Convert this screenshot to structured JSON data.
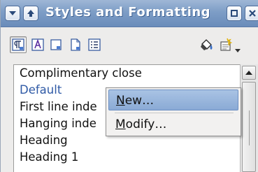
{
  "window": {
    "title": "Styles and Formatting"
  },
  "toolbar": {
    "buttons": [
      {
        "icon": "paragraph-styles-icon",
        "tooltip": ""
      },
      {
        "icon": "character-styles-icon"
      },
      {
        "icon": "frame-styles-icon"
      },
      {
        "icon": "page-styles-icon"
      },
      {
        "icon": "list-styles-icon"
      },
      {
        "icon": "fill-format-mode-icon"
      },
      {
        "icon": "new-style-from-selection-icon"
      }
    ]
  },
  "styles_list": {
    "items": [
      {
        "label": "Complimentary close"
      },
      {
        "label": "Default",
        "selected": true
      },
      {
        "label": "First line inde"
      },
      {
        "label": "Hanging inde"
      },
      {
        "label": "Heading"
      },
      {
        "label": "Heading 1"
      }
    ]
  },
  "context_menu": {
    "items": [
      {
        "label_mnemonic": "N",
        "label_rest": "ew…",
        "highlighted": true
      },
      {
        "label_mnemonic": "M",
        "label_rest": "odify…",
        "highlighted": false
      }
    ]
  },
  "colors": {
    "titlebar": "#7d9dc6",
    "selection_text": "#2f5aa6",
    "menu_highlight": "#9ab6dc"
  }
}
